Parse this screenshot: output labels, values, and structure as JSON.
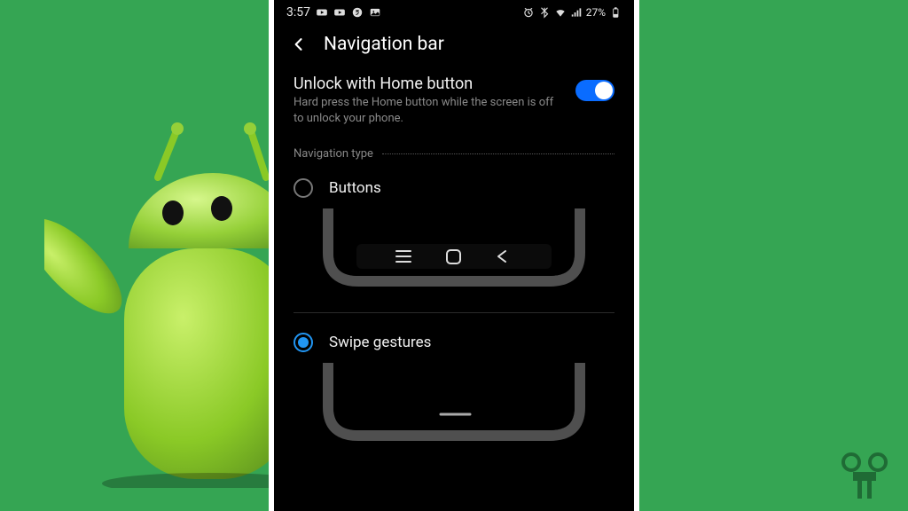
{
  "status": {
    "time": "3:57",
    "battery_text": "27%"
  },
  "header": {
    "title": "Navigation bar"
  },
  "unlock": {
    "title": "Unlock with Home button",
    "desc": "Hard press the Home button while the screen is off to unlock your phone.",
    "enabled": true
  },
  "section": {
    "label": "Navigation type"
  },
  "options": {
    "buttons": {
      "label": "Buttons",
      "selected": false
    },
    "gestures": {
      "label": "Swipe gestures",
      "selected": true
    }
  }
}
